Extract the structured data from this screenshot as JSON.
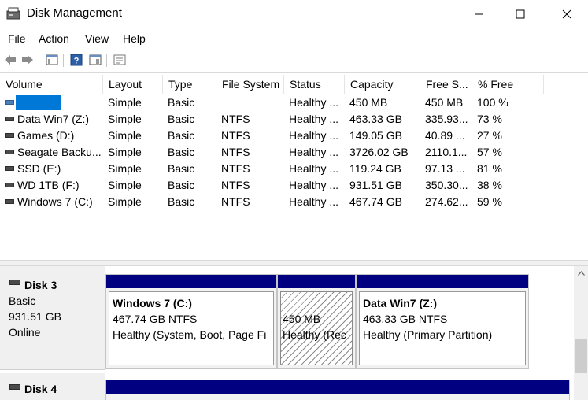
{
  "window": {
    "title": "Disk Management"
  },
  "menu": [
    "File",
    "Action",
    "View",
    "Help"
  ],
  "columns": [
    "Volume",
    "Layout",
    "Type",
    "File System",
    "Status",
    "Capacity",
    "Free S...",
    "% Free"
  ],
  "volumes": [
    {
      "name": "",
      "layout": "Simple",
      "type": "Basic",
      "fs": "",
      "status": "Healthy ...",
      "capacity": "450 MB",
      "free": "450 MB",
      "pct": "100 %"
    },
    {
      "name": "Data Win7 (Z:)",
      "layout": "Simple",
      "type": "Basic",
      "fs": "NTFS",
      "status": "Healthy ...",
      "capacity": "463.33 GB",
      "free": "335.93...",
      "pct": "73 %"
    },
    {
      "name": "Games (D:)",
      "layout": "Simple",
      "type": "Basic",
      "fs": "NTFS",
      "status": "Healthy ...",
      "capacity": "149.05 GB",
      "free": "40.89 ...",
      "pct": "27 %"
    },
    {
      "name": "Seagate Backu...",
      "layout": "Simple",
      "type": "Basic",
      "fs": "NTFS",
      "status": "Healthy ...",
      "capacity": "3726.02 GB",
      "free": "2110.1...",
      "pct": "57 %"
    },
    {
      "name": "SSD (E:)",
      "layout": "Simple",
      "type": "Basic",
      "fs": "NTFS",
      "status": "Healthy ...",
      "capacity": "119.24 GB",
      "free": "97.13 ...",
      "pct": "81 %"
    },
    {
      "name": "WD 1TB (F:)",
      "layout": "Simple",
      "type": "Basic",
      "fs": "NTFS",
      "status": "Healthy ...",
      "capacity": "931.51 GB",
      "free": "350.30...",
      "pct": "38 %"
    },
    {
      "name": "Windows 7 (C:)",
      "layout": "Simple",
      "type": "Basic",
      "fs": "NTFS",
      "status": "Healthy ...",
      "capacity": "467.74 GB",
      "free": "274.62...",
      "pct": "59 %"
    }
  ],
  "disks": [
    {
      "name": "Disk 3",
      "type": "Basic",
      "size": "931.51 GB",
      "state": "Online",
      "partitions": [
        {
          "title": "Windows 7  (C:)",
          "size": "467.74 GB NTFS",
          "status": "Healthy (System, Boot, Page Fi"
        },
        {
          "title": "",
          "size": "450 MB",
          "status": "Healthy (Rec"
        },
        {
          "title": "Data Win7  (Z:)",
          "size": "463.33 GB NTFS",
          "status": "Healthy (Primary Partition)"
        }
      ]
    },
    {
      "name": "Disk 4"
    }
  ],
  "colors": {
    "partition_bar": "#000080",
    "selection": "#0078d7"
  }
}
